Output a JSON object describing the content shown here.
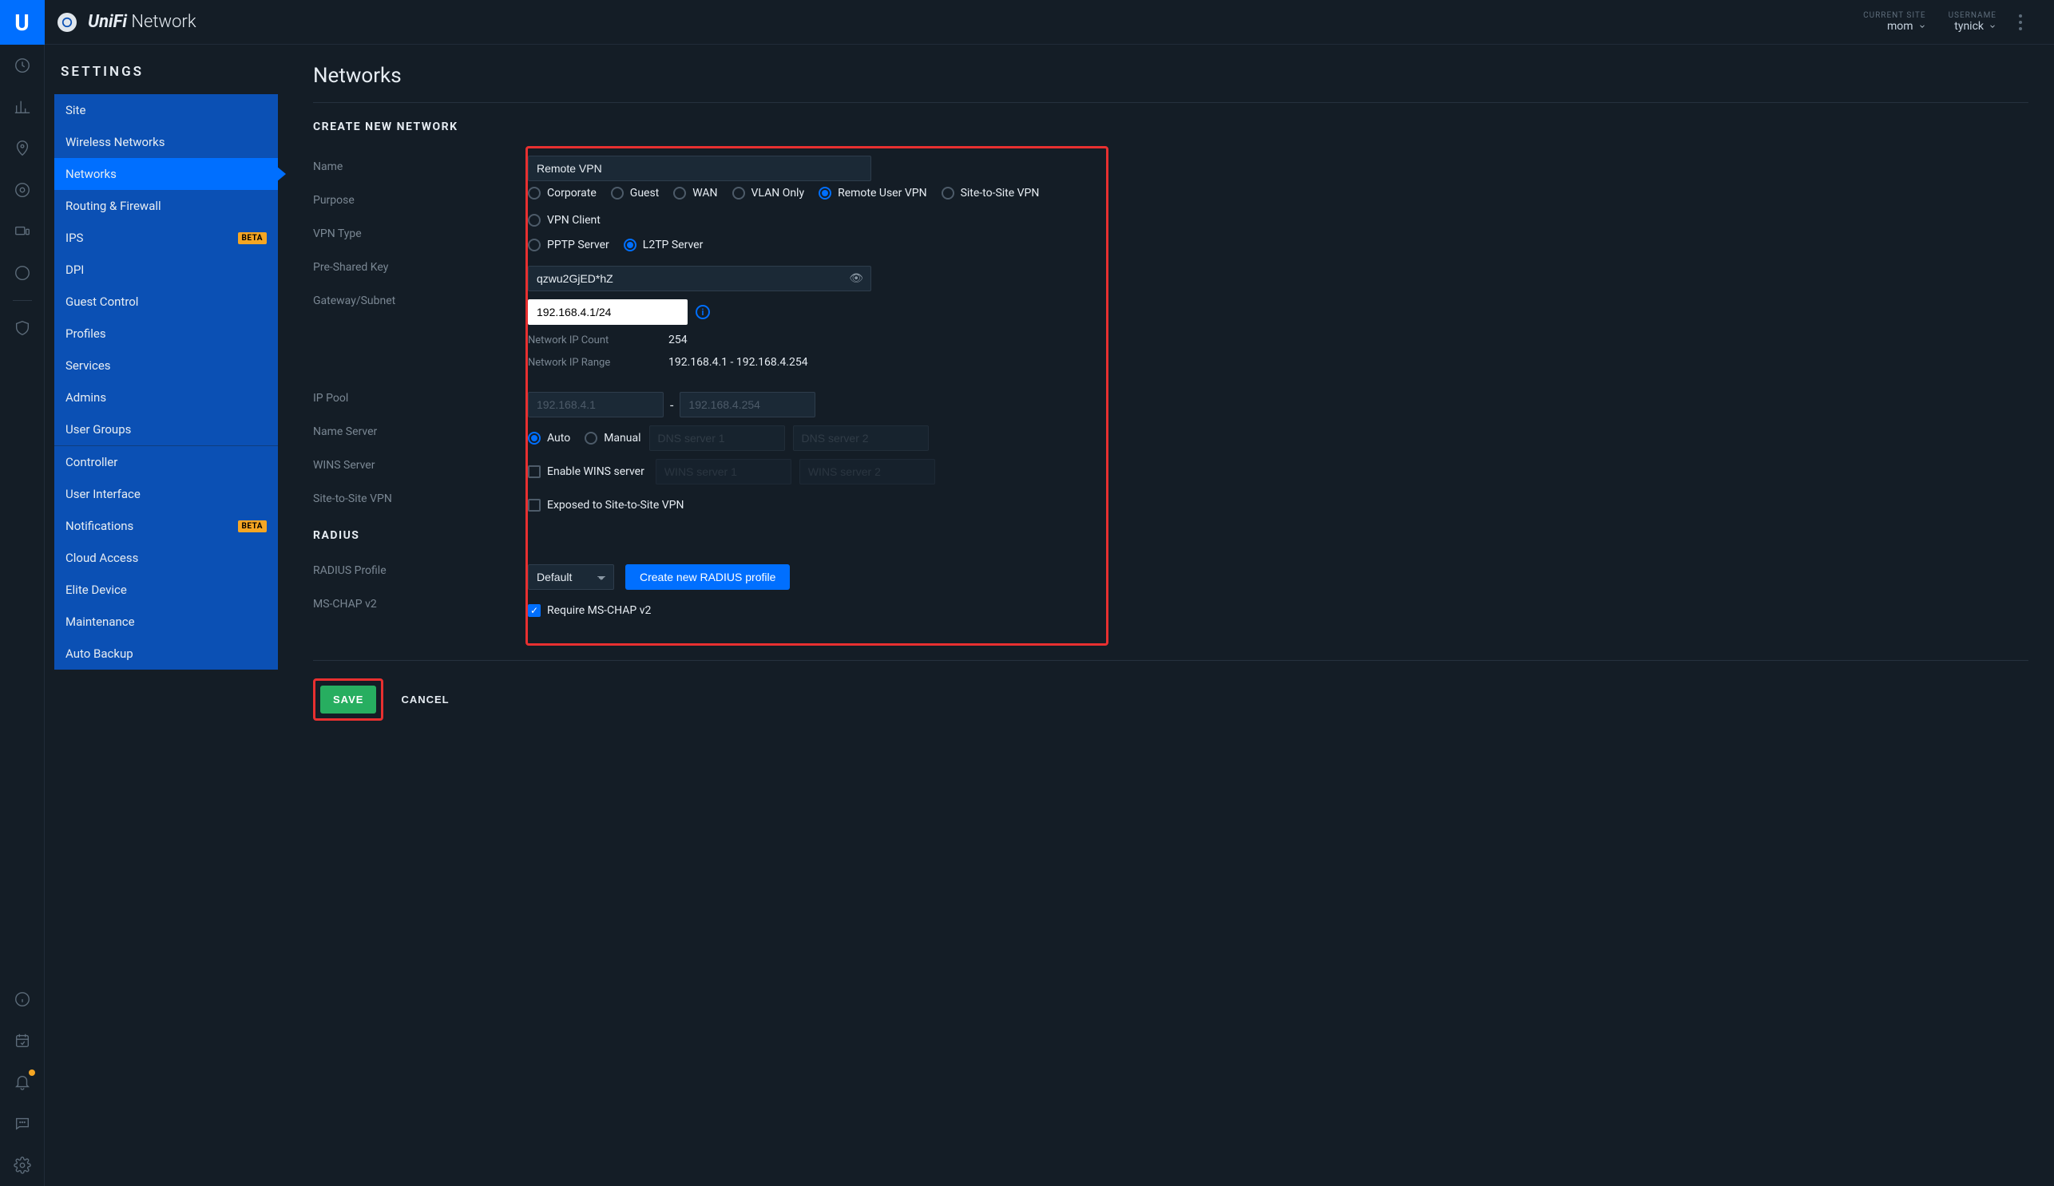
{
  "app": {
    "brand": "UniFi",
    "product": "Network"
  },
  "topbar": {
    "site_label": "CURRENT SITE",
    "site_value": "mom",
    "user_label": "USERNAME",
    "user_value": "tynick"
  },
  "settings": {
    "heading": "SETTINGS",
    "top_items": [
      {
        "label": "Site"
      },
      {
        "label": "Wireless Networks"
      },
      {
        "label": "Networks",
        "active": true
      },
      {
        "label": "Routing & Firewall"
      },
      {
        "label": "IPS",
        "badge": "BETA"
      },
      {
        "label": "DPI"
      },
      {
        "label": "Guest Control"
      },
      {
        "label": "Profiles"
      },
      {
        "label": "Services"
      },
      {
        "label": "Admins"
      },
      {
        "label": "User Groups"
      }
    ],
    "bottom_items": [
      {
        "label": "Controller"
      },
      {
        "label": "User Interface"
      },
      {
        "label": "Notifications",
        "badge": "BETA"
      },
      {
        "label": "Cloud Access"
      },
      {
        "label": "Elite Device"
      },
      {
        "label": "Maintenance"
      },
      {
        "label": "Auto Backup"
      }
    ]
  },
  "page": {
    "title": "Networks",
    "section": "CREATE NEW NETWORK",
    "labels": {
      "name": "Name",
      "purpose": "Purpose",
      "vpn_type": "VPN Type",
      "psk": "Pre-Shared Key",
      "gateway": "Gateway/Subnet",
      "ip_count": "Network IP Count",
      "ip_range": "Network IP Range",
      "ip_pool": "IP Pool",
      "name_server": "Name Server",
      "wins": "WINS Server",
      "s2s": "Site-to-Site VPN",
      "radius_section": "RADIUS",
      "radius_profile": "RADIUS Profile",
      "mschap": "MS-CHAP v2"
    },
    "values": {
      "name": "Remote VPN",
      "psk": "qzwu2GjED*hZ",
      "gateway": "192.168.4.1/24",
      "ip_count": "254",
      "ip_range": "192.168.4.1 - 192.168.4.254",
      "radius_profile": "Default"
    },
    "purpose_opts": [
      "Corporate",
      "Guest",
      "WAN",
      "VLAN Only",
      "Remote User VPN",
      "Site-to-Site VPN",
      "VPN Client"
    ],
    "purpose_selected": "Remote User VPN",
    "vpn_opts": [
      "PPTP Server",
      "L2TP Server"
    ],
    "vpn_selected": "L2TP Server",
    "name_server_opts": [
      "Auto",
      "Manual"
    ],
    "name_server_selected": "Auto",
    "placeholders": {
      "pool_start": "192.168.4.1",
      "pool_end": "192.168.4.254",
      "dns1": "DNS server 1",
      "dns2": "DNS server 2",
      "wins1": "WINS server 1",
      "wins2": "WINS server 2"
    },
    "checks": {
      "enable_wins": "Enable WINS server",
      "exposed_s2s": "Exposed to Site-to-Site VPN",
      "require_mschap": "Require MS-CHAP v2"
    },
    "buttons": {
      "create_radius": "Create new RADIUS profile",
      "save": "SAVE",
      "cancel": "CANCEL"
    }
  }
}
